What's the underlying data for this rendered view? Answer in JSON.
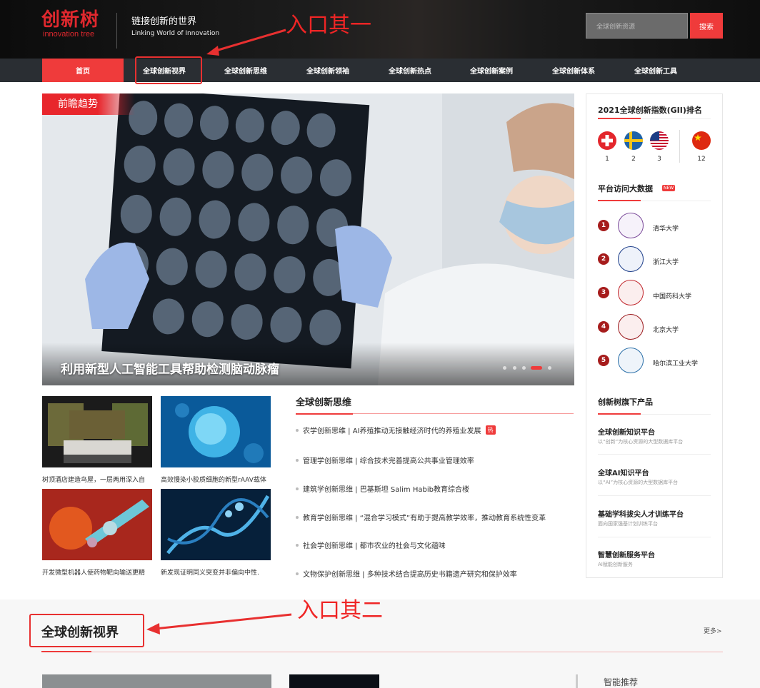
{
  "header": {
    "logo_cn": "创新树",
    "logo_en": "innovation tree",
    "slogan_cn": "链接创新的世界",
    "slogan_en": "Linking World of Innovation",
    "search_placeholder": "全球创新资源",
    "search_button": "搜索"
  },
  "nav": {
    "items": [
      "首页",
      "全球创新视界",
      "全球创新思维",
      "全球创新领袖",
      "全球创新热点",
      "全球创新案例",
      "全球创新体系",
      "全球创新工具"
    ],
    "active": "首页"
  },
  "annotations": {
    "entry_one": "入口其一",
    "entry_two": "入口其二"
  },
  "hero": {
    "tag": "前瞻趋势",
    "title": "利用新型人工智能工具帮助检测脑动脉瘤",
    "slide_count": 5,
    "active_slide": 4
  },
  "thumbs": [
    {
      "caption": "树顶酒店建造鸟屋，一层两用深入自"
    },
    {
      "caption": "高效慢染小胶质细胞的新型rAAV载体"
    },
    {
      "caption": "开发微型机器人使药物靶向输送更精"
    },
    {
      "caption": "新发现证明同义突变并非偏向中性."
    }
  ],
  "news": {
    "heading": "全球创新思维",
    "items": [
      {
        "text": "农学创新思维 | AI养殖推动无接触经济时代的养殖业发展",
        "badge": "热"
      },
      {
        "text": "管理学创新思维 | 综合技术完善提高公共事业管理效率"
      },
      {
        "text": "建筑学创新思维 | 巴基斯坦 Salim Habib教育综合楼"
      },
      {
        "text": "教育学创新思维 | “混合学习模式”有助于提高教学效率，推动教育系统性变革"
      },
      {
        "text": "社会学创新思维 | 都市农业的社会与文化蕴味"
      },
      {
        "text": "文物保护创新思维 | 多种技术结合提高历史书籍遗产研究和保护效率"
      }
    ]
  },
  "sidebar": {
    "gii_title": "2021全球创新指数(GII)排名",
    "flags": [
      {
        "country": "switzerland-flag",
        "rank": "1"
      },
      {
        "country": "sweden-flag",
        "rank": "2"
      },
      {
        "country": "usa-flag",
        "rank": "3"
      },
      {
        "country": "china-flag",
        "rank": "12"
      }
    ],
    "visits_title": "平台访问大数据",
    "visits_badge": "NEW",
    "universities": [
      {
        "rank": "1",
        "name": "清华大学"
      },
      {
        "rank": "2",
        "name": "浙江大学"
      },
      {
        "rank": "3",
        "name": "中国药科大学"
      },
      {
        "rank": "4",
        "name": "北京大学"
      },
      {
        "rank": "5",
        "name": "哈尔滨工业大学"
      }
    ],
    "products_title": "创新树旗下产品",
    "products": [
      {
        "title": "全球创新知识平台",
        "desc": "以“创新”为核心资源的大型数据库平台"
      },
      {
        "title": "全球AI知识平台",
        "desc": "以“AI”为核心资源的大型数据库平台"
      },
      {
        "title": "基础学科拔尖人才训练平台",
        "desc": "面向国家强基计划训练平台"
      },
      {
        "title": "智慧创新服务平台",
        "desc": "AI赋能创新服务"
      }
    ]
  },
  "section2": {
    "title": "全球创新视界",
    "more": "更多>",
    "recommend": "智能推荐"
  },
  "colors": {
    "accent": "#ef3b3b",
    "nav_bg": "#2a2e33",
    "annotation": "#e83030"
  }
}
